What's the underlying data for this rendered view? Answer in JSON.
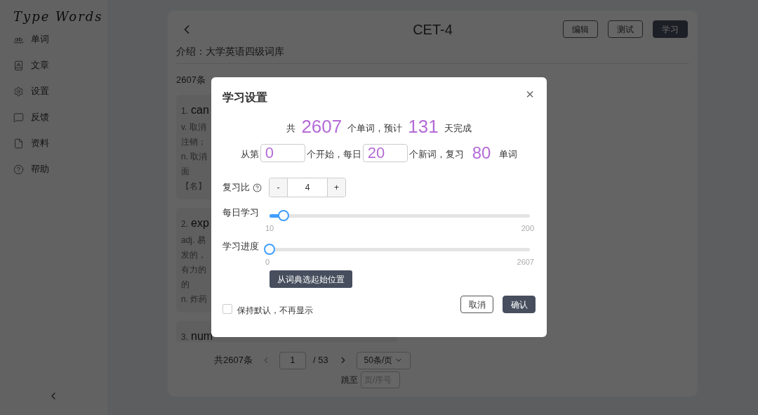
{
  "sidebar": {
    "logo": "Type Words",
    "items": [
      {
        "label": "单词"
      },
      {
        "label": "文章"
      },
      {
        "label": "设置"
      },
      {
        "label": "反馈"
      },
      {
        "label": "资料"
      },
      {
        "label": "帮助"
      }
    ]
  },
  "header": {
    "title": "CET-4",
    "buttons": [
      {
        "label": "编辑",
        "kind": "outline"
      },
      {
        "label": "测试",
        "kind": "outline"
      },
      {
        "label": "学习",
        "kind": "primary"
      }
    ]
  },
  "intro": "介绍：大学英语四级词库",
  "count": "2607条",
  "words": [
    {
      "number": "1.",
      "word": "can",
      "lines": [
        "v. 取消",
        "注销；",
        "n. 取消",
        "面",
        "【名】"
      ]
    },
    {
      "number": "2.",
      "word": "exp",
      "lines": [
        "adj. 易",
        "发的，",
        "有力的",
        "的",
        "n. 炸药"
      ]
    },
    {
      "number": "3.",
      "word": "num"
    }
  ],
  "pagination": {
    "total": "共2607条",
    "page": "1",
    "pages": "/ 53",
    "page_size": "50条/页",
    "jump_label": "跳至",
    "jump_placeholder": "页/序号"
  },
  "dialog": {
    "title": "学习设置",
    "close": "×",
    "summary": [
      {
        "kind": "text",
        "text": "共"
      },
      {
        "kind": "number",
        "text": "2607"
      },
      {
        "kind": "text",
        "text": "个单词，预计"
      },
      {
        "kind": "number",
        "text": "131"
      },
      {
        "kind": "text",
        "text": "天完成"
      }
    ],
    "plan": [
      {
        "kind": "text",
        "text": "从第"
      },
      {
        "kind": "input",
        "text": "0"
      },
      {
        "kind": "text",
        "text": "个开始，每日"
      },
      {
        "kind": "input",
        "text": "20"
      },
      {
        "kind": "text",
        "text": "个新词，复习"
      },
      {
        "kind": "number",
        "text": "80"
      },
      {
        "kind": "text",
        "text": "单词"
      }
    ],
    "ratio": {
      "label": "复习比",
      "minus": "-",
      "value": "4",
      "plus": "+"
    },
    "sliders": [
      {
        "label": "每日学习",
        "level": 0.053,
        "min": "10",
        "max": "200"
      },
      {
        "label": "学习进度",
        "level": 0,
        "min": "0",
        "max": "2607"
      }
    ],
    "pick_button": "从词典选起始位置",
    "remember": {
      "label": "保持默认，不再显示",
      "checked": false
    },
    "buttons": [
      {
        "label": "取消",
        "kind": "outline"
      },
      {
        "label": "确认",
        "kind": "primary"
      }
    ]
  }
}
